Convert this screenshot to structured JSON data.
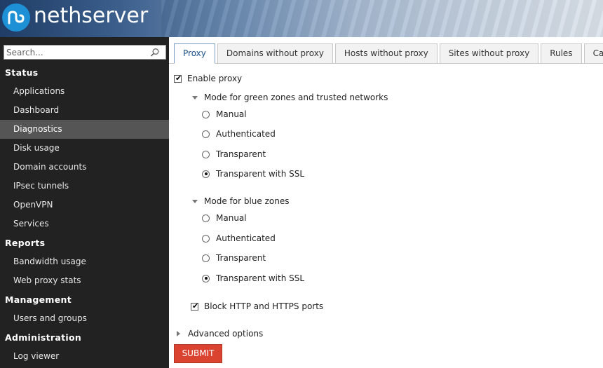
{
  "header": {
    "logo_text": "nethserver",
    "colors": {
      "logo_circle": "#1e90d6"
    }
  },
  "sidebar": {
    "search_placeholder": "Search...",
    "sections": [
      {
        "title": "Status",
        "items": [
          "Applications",
          "Dashboard",
          "Diagnostics",
          "Disk usage",
          "Domain accounts",
          "IPsec tunnels",
          "OpenVPN",
          "Services"
        ]
      },
      {
        "title": "Reports",
        "items": [
          "Bandwidth usage",
          "Web proxy stats"
        ]
      },
      {
        "title": "Management",
        "items": [
          "Users and groups"
        ]
      },
      {
        "title": "Administration",
        "items": [
          "Log viewer"
        ]
      }
    ],
    "active_item": "Diagnostics"
  },
  "tabs": [
    "Proxy",
    "Domains without proxy",
    "Hosts without proxy",
    "Sites without proxy",
    "Rules",
    "Cache"
  ],
  "active_tab": "Proxy",
  "form": {
    "enable_proxy": {
      "label": "Enable proxy",
      "checked": true
    },
    "green": {
      "title": "Mode for green zones and trusted networks",
      "options": [
        "Manual",
        "Authenticated",
        "Transparent",
        "Transparent with SSL"
      ],
      "selected": "Transparent with SSL"
    },
    "blue": {
      "title": "Mode for blue zones",
      "options": [
        "Manual",
        "Authenticated",
        "Transparent",
        "Transparent with SSL"
      ],
      "selected": "Transparent with SSL"
    },
    "block_ports": {
      "label": "Block HTTP and HTTPS ports",
      "checked": true
    },
    "advanced": "Advanced options",
    "submit": "SUBMIT"
  }
}
